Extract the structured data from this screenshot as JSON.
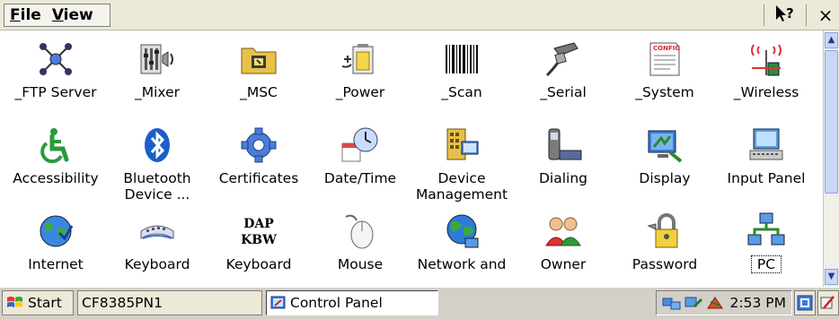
{
  "menu": {
    "file": "File",
    "view": "View",
    "help_icon": "help-cursor-icon",
    "close_label": "×"
  },
  "colors": {
    "accent": "#2a5bd7",
    "taskbar": "#d4d0c8",
    "menubar": "#ece9d8"
  },
  "icons": [
    {
      "label": "_FTP Server",
      "icon": "ftp-server-network-icon"
    },
    {
      "label": "_Mixer",
      "icon": "mixer-speaker-icon"
    },
    {
      "label": "_MSC",
      "icon": "msc-folder-icon"
    },
    {
      "label": "_Power",
      "icon": "power-battery-icon"
    },
    {
      "label": "_Scan",
      "icon": "barcode-scan-icon"
    },
    {
      "label": "_Serial",
      "icon": "serial-connector-icon"
    },
    {
      "label": "_System",
      "icon": "system-config-icon",
      "badge": "CONFIG"
    },
    {
      "label": "_Wireless",
      "icon": "wireless-antenna-icon"
    },
    {
      "label": "Accessibility",
      "icon": "accessibility-wheelchair-icon"
    },
    {
      "label": "Bluetooth\nDevice ...",
      "icon": "bluetooth-icon"
    },
    {
      "label": "Certificates",
      "icon": "certificates-gear-icon"
    },
    {
      "label": "Date/Time",
      "icon": "date-time-clock-icon"
    },
    {
      "label": "Device\nManagement",
      "icon": "device-management-icon"
    },
    {
      "label": "Dialing",
      "icon": "dialing-phone-icon"
    },
    {
      "label": "Display",
      "icon": "display-monitor-icon"
    },
    {
      "label": "Input Panel",
      "icon": "input-panel-icon"
    },
    {
      "label": "Internet",
      "icon": "internet-globe-icon"
    },
    {
      "label": "Keyboard",
      "icon": "keyboard-icon"
    },
    {
      "label": "Keyboard",
      "icon": "dap-kbw-text-icon",
      "text": "DAP\nKBW"
    },
    {
      "label": "Mouse",
      "icon": "mouse-icon"
    },
    {
      "label": "Network and",
      "icon": "network-globe-icon"
    },
    {
      "label": "Owner",
      "icon": "owner-people-icon"
    },
    {
      "label": "Password",
      "icon": "password-padlock-icon"
    },
    {
      "label": "PC",
      "icon": "pc-connection-icon",
      "focused": true
    }
  ],
  "taskbar": {
    "start": "Start",
    "device": "CF8385PN1",
    "window": "Control Panel",
    "time": "2:53 PM"
  }
}
